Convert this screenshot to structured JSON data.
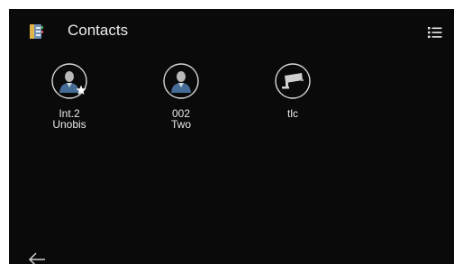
{
  "header": {
    "title": "Contacts",
    "app_icon": "address-book-icon",
    "menu_icon": "list-view-icon"
  },
  "contacts": [
    {
      "line1": "Int.2",
      "line2": "Unobis",
      "avatar": "person-icon",
      "badge": "star-icon"
    },
    {
      "line1": "002",
      "line2": "Two",
      "avatar": "person-icon"
    },
    {
      "line1": "tlc",
      "line2": "",
      "avatar": "camera-icon"
    }
  ],
  "footer": {
    "back_icon": "back-arrow-icon"
  },
  "colors": {
    "background": "#0a0a0a",
    "text": "#ececec",
    "avatar_border": "#d8d8d8"
  }
}
